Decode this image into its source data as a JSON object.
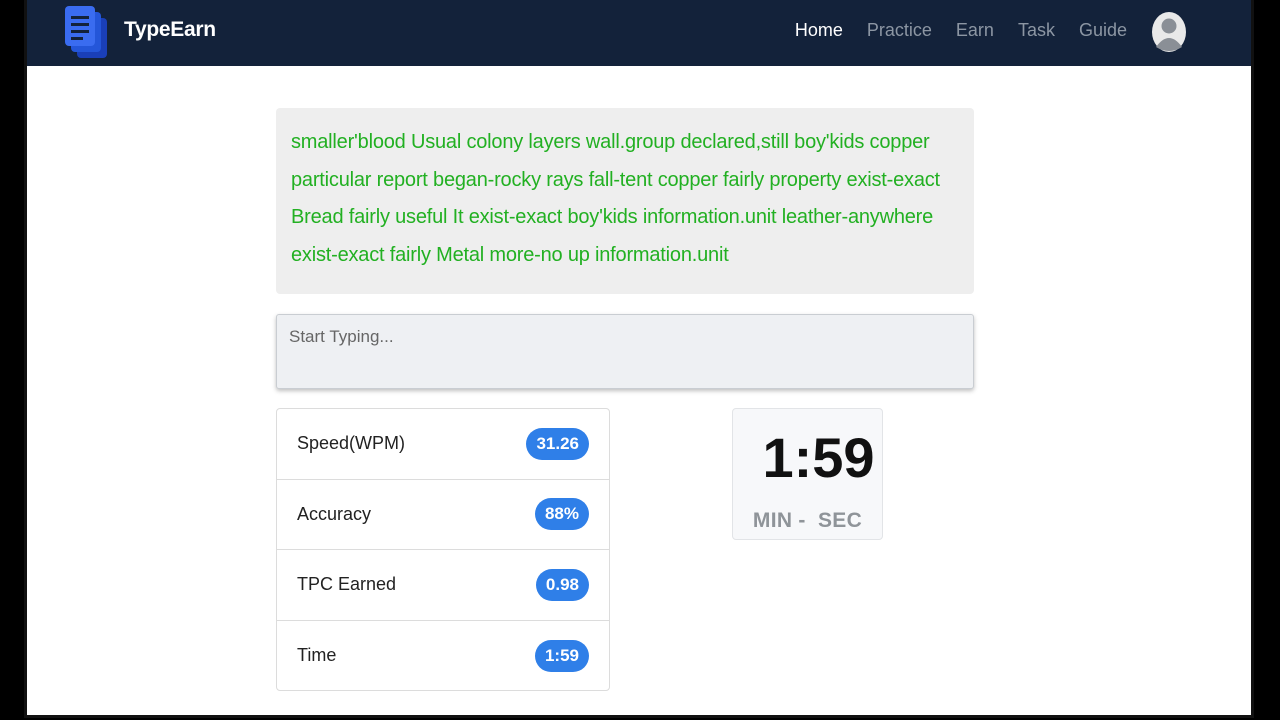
{
  "navbar": {
    "brand": "TypeEarn",
    "links": [
      {
        "label": "Home",
        "active": true
      },
      {
        "label": "Practice",
        "active": false
      },
      {
        "label": "Earn",
        "active": false
      },
      {
        "label": "Task",
        "active": false
      },
      {
        "label": "Guide",
        "active": false
      }
    ],
    "logo_icon": "stacked-document-icon",
    "avatar_icon": "user-avatar-icon"
  },
  "prompt": {
    "lines": [
      "smaller'blood Usual colony layers wall.group declared,still boy'kids copper",
      "particular report began-rocky rays fall-tent copper fairly property exist-exact",
      "Bread fairly useful It exist-exact boy'kids information.unit leather-anywhere",
      "exist-exact fairly Metal more-no up information.unit"
    ]
  },
  "typing": {
    "placeholder": "Start Typing...",
    "value": ""
  },
  "stats": [
    {
      "label": "Speed(WPM)",
      "value": "31.26"
    },
    {
      "label": "Accuracy",
      "value": "88%"
    },
    {
      "label": "TPC Earned",
      "value": "0.98"
    },
    {
      "label": "Time",
      "value": "1:59"
    }
  ],
  "timer": {
    "value": "1:59",
    "units": "MIN -  SEC"
  },
  "colors": {
    "navbar": "#13223a",
    "prompt_text": "#22b022",
    "badge": "#2f7fe8"
  }
}
